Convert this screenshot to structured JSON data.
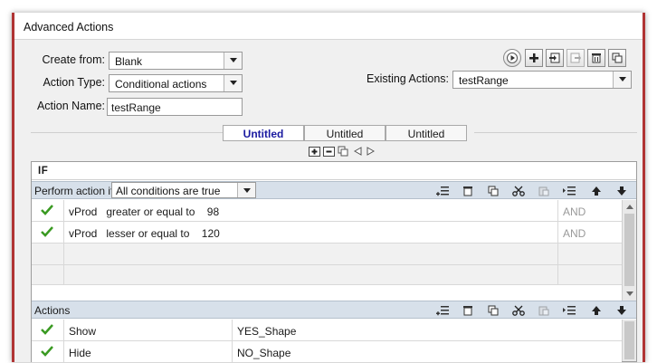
{
  "window": {
    "title": "Advanced Actions"
  },
  "form": {
    "create_from_label": "Create from:",
    "create_from_value": "Blank",
    "action_type_label": "Action Type:",
    "action_type_value": "Conditional actions",
    "action_name_label": "Action Name:",
    "action_name_value": "testRange",
    "existing_actions_label": "Existing Actions:",
    "existing_actions_value": "testRange"
  },
  "toolbar_icons": [
    "play-icon",
    "add-icon",
    "import-icon",
    "export-icon",
    "delete-icon",
    "duplicate-icon"
  ],
  "tabs": [
    {
      "label": "Untitled",
      "active": true
    },
    {
      "label": "Untitled",
      "active": false
    },
    {
      "label": "Untitled",
      "active": false
    }
  ],
  "if_panel": {
    "heading": "IF",
    "perform_label": "Perform action if:",
    "perform_value": "All conditions are true",
    "conditions": [
      {
        "variable": "vProd",
        "operator": "greater or equal to",
        "value": "98",
        "joiner": "AND"
      },
      {
        "variable": "vProd",
        "operator": "lesser or equal to",
        "value": "120",
        "joiner": "AND"
      }
    ]
  },
  "actions_panel": {
    "heading": "Actions",
    "rows": [
      {
        "command": "Show",
        "target": "YES_Shape"
      },
      {
        "command": "Hide",
        "target": "NO_Shape"
      }
    ]
  },
  "colors": {
    "accent_border": "#b03434",
    "bar_bg": "#d7e0ea",
    "active_tab": "#1a1aa0",
    "check": "#3a9a22"
  }
}
